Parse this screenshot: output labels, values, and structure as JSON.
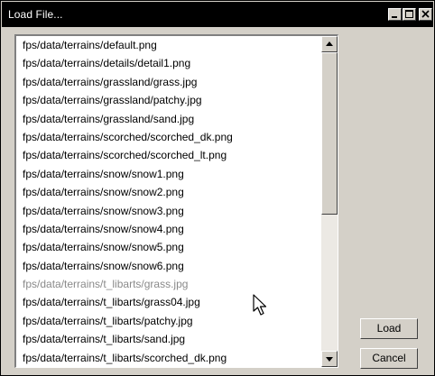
{
  "window": {
    "title": "Load File..."
  },
  "file_list": {
    "items": [
      {
        "path": "fps/data/terrains/default.png",
        "state": "normal"
      },
      {
        "path": "fps/data/terrains/details/detail1.png",
        "state": "normal"
      },
      {
        "path": "fps/data/terrains/grassland/grass.jpg",
        "state": "normal"
      },
      {
        "path": "fps/data/terrains/grassland/patchy.jpg",
        "state": "normal"
      },
      {
        "path": "fps/data/terrains/grassland/sand.jpg",
        "state": "normal"
      },
      {
        "path": "fps/data/terrains/scorched/scorched_dk.png",
        "state": "normal"
      },
      {
        "path": "fps/data/terrains/scorched/scorched_lt.png",
        "state": "normal"
      },
      {
        "path": "fps/data/terrains/snow/snow1.png",
        "state": "normal"
      },
      {
        "path": "fps/data/terrains/snow/snow2.png",
        "state": "normal"
      },
      {
        "path": "fps/data/terrains/snow/snow3.png",
        "state": "normal"
      },
      {
        "path": "fps/data/terrains/snow/snow4.png",
        "state": "normal"
      },
      {
        "path": "fps/data/terrains/snow/snow5.png",
        "state": "normal"
      },
      {
        "path": "fps/data/terrains/snow/snow6.png",
        "state": "normal"
      },
      {
        "path": "fps/data/terrains/t_libarts/grass.jpg",
        "state": "dimmed"
      },
      {
        "path": "fps/data/terrains/t_libarts/grass04.jpg",
        "state": "normal"
      },
      {
        "path": "fps/data/terrains/t_libarts/patchy.jpg",
        "state": "normal"
      },
      {
        "path": "fps/data/terrains/t_libarts/sand.jpg",
        "state": "normal"
      },
      {
        "path": "fps/data/terrains/t_libarts/scorched_dk.png",
        "state": "normal"
      }
    ]
  },
  "buttons": {
    "load_label": "Load",
    "cancel_label": "Cancel"
  },
  "icons": {
    "minimize": "minimize-icon",
    "maximize": "maximize-icon",
    "close": "close-icon",
    "scroll_up": "arrow-up-icon",
    "scroll_down": "arrow-down-icon",
    "cursor": "mouse-pointer-icon"
  },
  "colors": {
    "titlebar": "#000000",
    "window_face": "#d4d0c8",
    "list_background": "#ffffff",
    "dimmed_text": "#8a8a8a"
  }
}
